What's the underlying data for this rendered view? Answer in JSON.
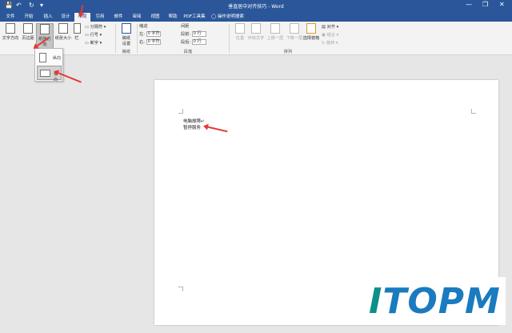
{
  "window": {
    "title": "垂直居中对齐技巧 - Word",
    "controls": {
      "minimize": "—",
      "restore": "❐",
      "close": "✕"
    },
    "quick_access": {
      "save": "💾",
      "undo": "↶",
      "redo": "↻",
      "more": "▾"
    }
  },
  "tabs": [
    "文件",
    "开始",
    "插入",
    "设计",
    "布局",
    "引用",
    "邮件",
    "审阅",
    "视图",
    "帮助",
    "PDF工具集"
  ],
  "active_tab": "布局",
  "tell_me": "操作说明搜索",
  "ribbon": {
    "page_setup": {
      "text_direction": "文字方向",
      "margins": "页边距",
      "orientation": "纸张方向",
      "size": "纸张大小",
      "columns": "栏",
      "breaks": "分隔符",
      "line_numbers": "行号",
      "hyphenation": "断字"
    },
    "draft_paper": {
      "button": "稿纸\n设置",
      "label": "稿纸"
    },
    "paragraph": {
      "indent_title": "缩进",
      "spacing_title": "间距",
      "left_label": "左:",
      "right_label": "右:",
      "before_label": "段前:",
      "after_label": "段后:",
      "left_value": "0 字符",
      "right_value": "0 字符",
      "before_value": "0 行",
      "after_value": "0 行",
      "label": "段落"
    },
    "arrange": {
      "position": "位置",
      "wrap_text": "环绕文字",
      "bring_forward": "上移一层",
      "send_backward": "下移一层",
      "selection_pane": "选择窗格",
      "align": "对齐",
      "group": "组合",
      "rotate": "旋转",
      "label": "排列"
    }
  },
  "orientation_menu": {
    "portrait": "纵向",
    "landscape": "横向"
  },
  "document": {
    "lines": [
      "电脑故障↵",
      "暂停服务"
    ]
  },
  "watermark": {
    "text": "ITOPM",
    "colors": [
      "#0d8f8a",
      "#1a7bbf",
      "#1a7bbf",
      "#1a7bbf",
      "#1a7bbf"
    ]
  },
  "colors": {
    "accent": "#2b579a",
    "arrow": "#e53935"
  }
}
